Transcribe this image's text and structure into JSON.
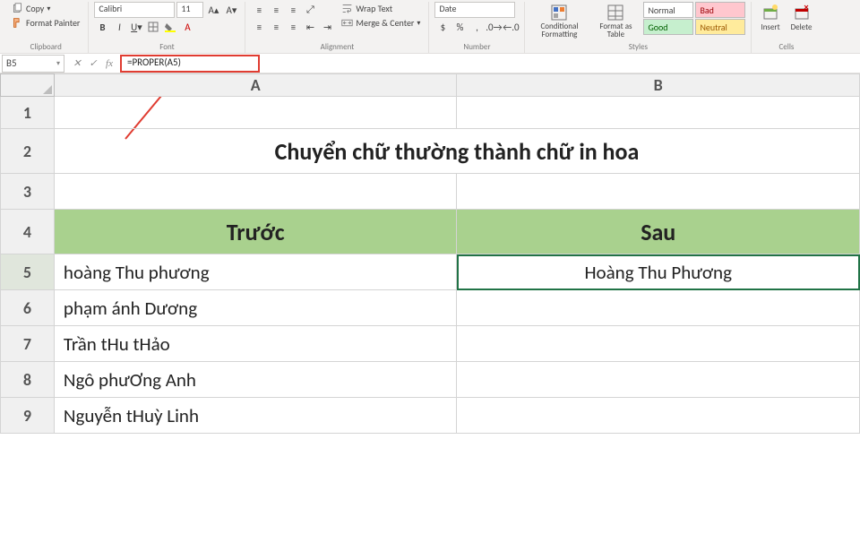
{
  "ribbon": {
    "clipboard": {
      "label": "Clipboard",
      "copy": "Copy",
      "format_painter": "Format Painter"
    },
    "font": {
      "label": "Font",
      "name": "Calibri",
      "size": "11"
    },
    "alignment": {
      "label": "Alignment",
      "wrap": "Wrap Text",
      "merge": "Merge & Center"
    },
    "number": {
      "label": "Number",
      "format": "Date"
    },
    "styles": {
      "label": "Styles",
      "cond": "Conditional Formatting",
      "table": "Format as Table",
      "normal": "Normal",
      "bad": "Bad",
      "good": "Good",
      "neutral": "Neutral"
    },
    "cells": {
      "label": "Cells",
      "insert": "Insert",
      "delete": "Delete"
    }
  },
  "fbar": {
    "ref": "B5",
    "formula": "=PROPER(A5)"
  },
  "columns": [
    "A",
    "B"
  ],
  "rows": [
    "1",
    "2",
    "3",
    "4",
    "5",
    "6",
    "7",
    "8",
    "9"
  ],
  "sheet": {
    "title": "Chuyển chữ thường thành chữ in hoa",
    "header_a": "Trước",
    "header_b": "Sau",
    "a5": "hoàng Thu phương",
    "b5": "Hoàng Thu Phương",
    "a6": "phạm ánh Dương",
    "a7": "Trần tHu tHảo",
    "a8": "Ngô phưƠng Anh",
    "a9": "Nguyễn tHuỳ Linh"
  }
}
